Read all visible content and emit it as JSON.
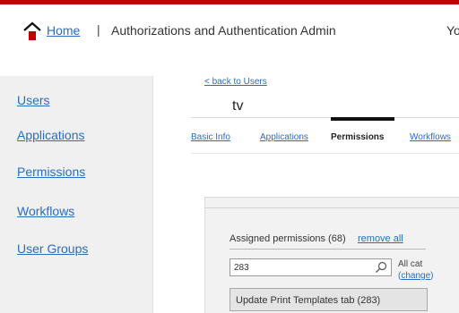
{
  "header": {
    "home_label": "Home",
    "separator": "|",
    "app_title": "Authorizations and Authentication Admin",
    "user_truncated": "Yo"
  },
  "sidebar": {
    "items": [
      {
        "label": "Users"
      },
      {
        "label": "Applications"
      },
      {
        "label": "Permissions"
      },
      {
        "label": "Workflows"
      },
      {
        "label": "User Groups"
      }
    ]
  },
  "main": {
    "back_link": "< back to Users",
    "user_name": "tv",
    "tabs": [
      {
        "label": "Basic Info",
        "active": false
      },
      {
        "label": "Applications",
        "active": false
      },
      {
        "label": "Permissions",
        "active": true
      },
      {
        "label": "Workflows",
        "active": false
      }
    ],
    "assigned": {
      "label": "Assigned permissions (68)",
      "remove_all": "remove all"
    },
    "search": {
      "value": "283",
      "category_label": "All cat",
      "change_open": "(",
      "change_label": "change",
      "change_close": ")"
    },
    "results": [
      {
        "label": "Update Print Templates tab (283)"
      }
    ]
  },
  "colors": {
    "accent_top_border": "#c00000",
    "link": "#2a6ebb",
    "sidebar_bg": "#f0f0f0",
    "panel_bg": "#f2f2f2"
  }
}
